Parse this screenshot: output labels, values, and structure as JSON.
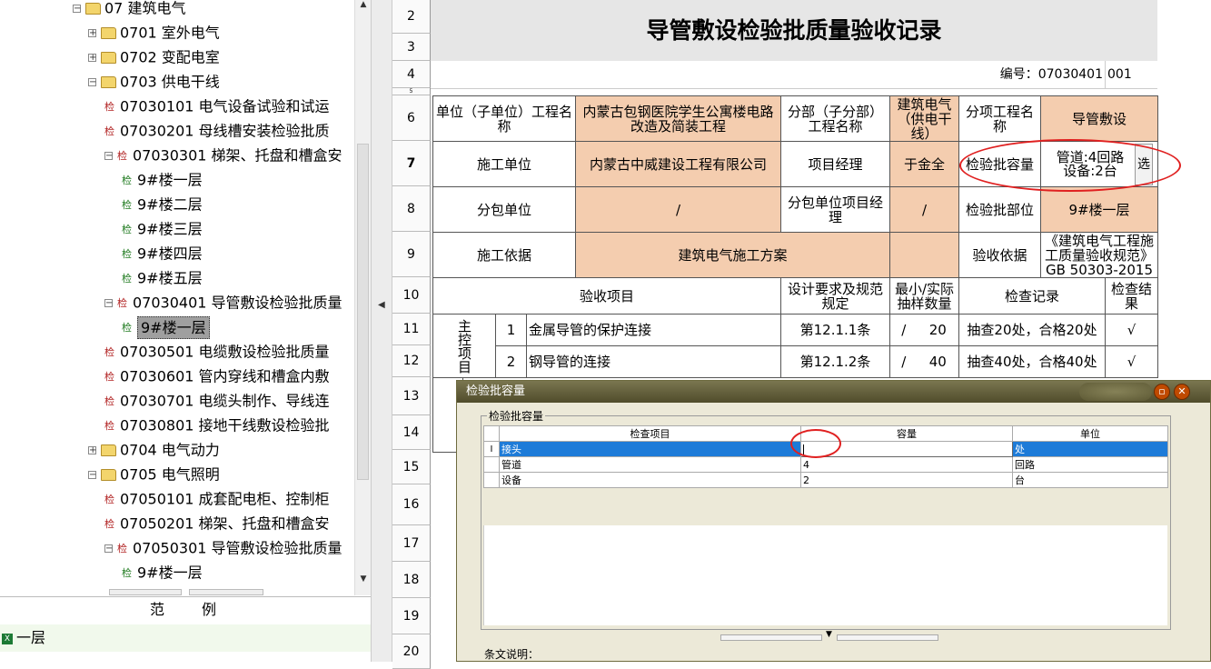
{
  "tree": {
    "nodes": [
      {
        "label": "07 建筑电气",
        "kind": "folder-open",
        "expander": "−"
      },
      {
        "label": "0701 室外电气",
        "kind": "folder",
        "expander": "+"
      },
      {
        "label": "0702 变配电室",
        "kind": "folder",
        "expander": "+"
      },
      {
        "label": "0703 供电干线",
        "kind": "folder-open",
        "expander": "−"
      },
      {
        "label": "07030101 电气设备试验和试运",
        "kind": "check-red"
      },
      {
        "label": "07030201 母线槽安装检验批质",
        "kind": "check-red"
      },
      {
        "label": "07030301 梯架、托盘和槽盒安",
        "kind": "check-red",
        "expander": "−"
      },
      {
        "label": "9#楼一层",
        "kind": "check-green"
      },
      {
        "label": "9#楼二层",
        "kind": "check-green"
      },
      {
        "label": "9#楼三层",
        "kind": "check-green"
      },
      {
        "label": "9#楼四层",
        "kind": "check-green"
      },
      {
        "label": "9#楼五层",
        "kind": "check-green"
      },
      {
        "label": "07030401 导管敷设检验批质量",
        "kind": "check-red",
        "expander": "−"
      },
      {
        "label": "9#楼一层",
        "kind": "check-green",
        "selected": true
      },
      {
        "label": "07030501 电缆敷设检验批质量",
        "kind": "check-red"
      },
      {
        "label": "07030601 管内穿线和槽盒内敷",
        "kind": "check-red"
      },
      {
        "label": "07030701 电缆头制作、导线连",
        "kind": "check-red"
      },
      {
        "label": "07030801 接地干线敷设检验批",
        "kind": "check-red"
      },
      {
        "label": "0704 电气动力",
        "kind": "folder",
        "expander": "+"
      },
      {
        "label": "0705 电气照明",
        "kind": "folder-open",
        "expander": "−"
      },
      {
        "label": "07050101 成套配电柜、控制柜",
        "kind": "check-red"
      },
      {
        "label": "07050201 梯架、托盘和槽盒安",
        "kind": "check-red"
      },
      {
        "label": "07050301 导管敷设检验批质量",
        "kind": "check-red",
        "expander": "−"
      },
      {
        "label": "9#楼一层",
        "kind": "check-green"
      }
    ],
    "check_glyph": "检"
  },
  "legend": {
    "col1": "范",
    "col2": "例",
    "item": "一层",
    "item_icon": "X"
  },
  "row_numbers": [
    "2",
    "3",
    "4",
    "5",
    "6",
    "7",
    "8",
    "9",
    "10",
    "11",
    "12",
    "13",
    "14",
    "15",
    "16",
    "17",
    "18",
    "19",
    "20"
  ],
  "sheet": {
    "title": "导管敷设检验批质量验收记录",
    "number_label": "编号：07030401",
    "number_value": "001",
    "r6": {
      "a": "单位（子单位）工程名称",
      "b": "内蒙古包钢医院学生公寓楼电路改造及简装工程",
      "c": "分部（子分部）工程名称",
      "d": "建筑电气（供电干线）",
      "e": "分项工程名称",
      "f": "导管敷设"
    },
    "r7": {
      "a": "施工单位",
      "b": "内蒙古中威建设工程有限公司",
      "c": "项目经理",
      "d": "于金全",
      "e": "检验批容量",
      "f1": "管道:4回路",
      "f2": "设备:2台",
      "btn": "选"
    },
    "r8": {
      "a": "分包单位",
      "b": "/",
      "c": "分包单位项目经理",
      "d": "/",
      "e": "检验批部位",
      "f": "9#楼一层"
    },
    "r9": {
      "a": "施工依据",
      "b": "建筑电气施工方案",
      "c": "验收依据",
      "d": "《建筑电气工程施工质量验收规范》GB 50303-2015"
    },
    "r10": {
      "a": "验收项目",
      "b": "设计要求及规范规定",
      "c": "最小/实际抽样数量",
      "d": "检查记录",
      "e": "检查结果"
    },
    "main_label": "主控项目",
    "items": [
      {
        "no": "1",
        "name": "金属导管的保护连接",
        "spec": "第12.1.1条",
        "slash": "/",
        "actual": "20",
        "record": "抽查20处，合格20处",
        "result": "√"
      },
      {
        "no": "2",
        "name": "钢导管的连接",
        "spec": "第12.1.2条",
        "slash": "/",
        "actual": "40",
        "record": "抽查40处，合格40处",
        "result": "√"
      }
    ]
  },
  "dialog": {
    "title": "检验批容量",
    "group_label": "检验批容量",
    "headers": {
      "item": "检查项目",
      "capacity": "容量",
      "unit": "单位"
    },
    "rows": [
      {
        "indicator": "I",
        "item": "接头",
        "capacity": "",
        "unit": "处",
        "selected": true
      },
      {
        "indicator": "",
        "item": "管道",
        "capacity": "4",
        "unit": "回路"
      },
      {
        "indicator": "",
        "item": "设备",
        "capacity": "2",
        "unit": "台"
      }
    ],
    "note_label": "条文说明：",
    "min_glyph": "▫",
    "close_glyph": "✕"
  },
  "colors": {
    "input_cell": "#f4cdaf",
    "annotation": "#e02020",
    "selection": "#1d7bd8"
  }
}
